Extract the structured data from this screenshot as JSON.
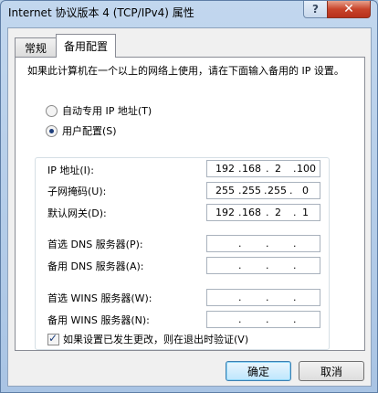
{
  "window": {
    "title": "Internet 协议版本 4 (TCP/IPv4) 属性",
    "help_label": "?",
    "close_label": "✕"
  },
  "tabs": [
    {
      "label": "常规",
      "selected": false
    },
    {
      "label": "备用配置",
      "selected": true
    }
  ],
  "intro_text": "如果此计算机在一个以上的网络上使用，请在下面输入备用的 IP 设置。",
  "radios": {
    "auto_label": "自动专用 IP 地址(T)",
    "user_label": "用户配置(S)",
    "selected": "user"
  },
  "fields": {
    "ip": {
      "label": "IP 地址(I):",
      "octets": [
        "192",
        "168",
        "2",
        "100"
      ]
    },
    "mask": {
      "label": "子网掩码(U):",
      "octets": [
        "255",
        "255",
        "255",
        "0"
      ]
    },
    "gateway": {
      "label": "默认网关(D):",
      "octets": [
        "192",
        "168",
        "2",
        "1"
      ]
    },
    "dns1": {
      "label": "首选 DNS 服务器(P):",
      "octets": [
        "",
        "",
        "",
        ""
      ]
    },
    "dns2": {
      "label": "备用 DNS 服务器(A):",
      "octets": [
        "",
        "",
        "",
        ""
      ]
    },
    "wins1": {
      "label": "首选 WINS 服务器(W):",
      "octets": [
        "",
        "",
        "",
        ""
      ]
    },
    "wins2": {
      "label": "备用 WINS 服务器(N):",
      "octets": [
        "",
        "",
        "",
        ""
      ]
    }
  },
  "validate_checkbox": {
    "label": "如果设置已发生更改，则在退出时验证(V)",
    "checked": true
  },
  "buttons": {
    "ok_label": "确定",
    "cancel_label": "取消"
  },
  "colors": {
    "title_bar": "#b9d1ea",
    "close_button": "#c8442b",
    "dialog_bg": "#f0f0f0"
  }
}
